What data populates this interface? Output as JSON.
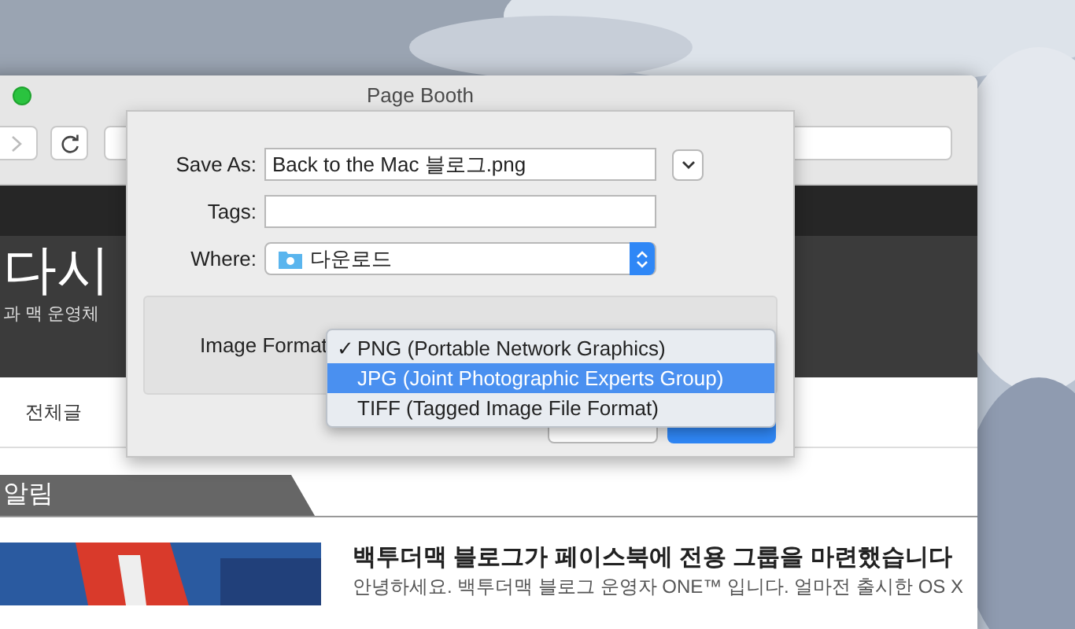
{
  "window": {
    "title": "Page Booth"
  },
  "page": {
    "site_title": "다시",
    "site_subtitle": "과 맥 운영체",
    "nav": [
      {
        "label": "전체글"
      }
    ],
    "section": "알림",
    "post": {
      "title": "백투더맥 블로그가 페이스북에 전용 그룹을 마련했습니다",
      "excerpt": "안녕하세요. 백투더맥 블로그 운영자 ONE™ 입니다. 얼마전 출시한 OS X"
    }
  },
  "dialog": {
    "save_as": {
      "label": "Save As:",
      "value": "Back to the Mac 블로그.png"
    },
    "tags": {
      "label": "Tags:"
    },
    "where": {
      "label": "Where:",
      "value": "다운로드"
    },
    "format": {
      "label": "Image Format",
      "check_mark": "✓",
      "options": [
        {
          "label": "PNG (Portable Network Graphics)",
          "checked": true,
          "highlighted": false
        },
        {
          "label": "JPG (Joint Photographic Experts Group)",
          "checked": false,
          "highlighted": true
        },
        {
          "label": "TIFF (Tagged Image File Format)",
          "checked": false,
          "highlighted": false
        }
      ]
    },
    "buttons": [
      {
        "kind": "normal"
      },
      {
        "kind": "default"
      }
    ]
  }
}
